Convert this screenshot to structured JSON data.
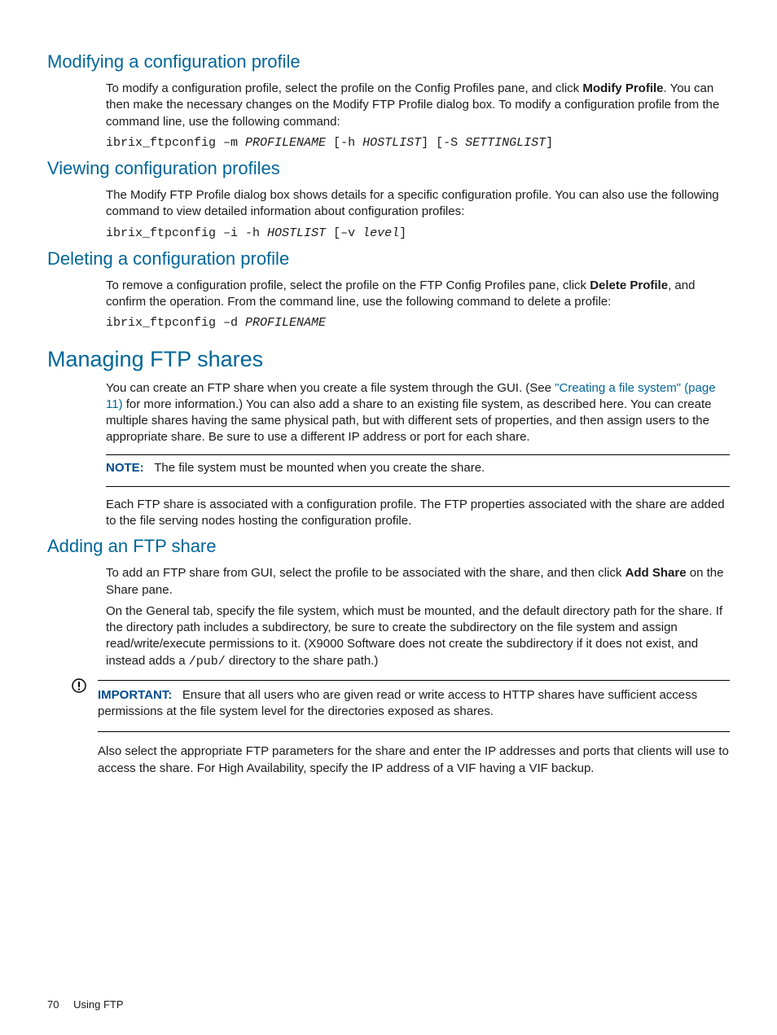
{
  "sections": {
    "modify": {
      "heading": "Modifying a configuration profile",
      "p_before": "To modify a configuration profile, select the profile on the Config Profiles pane, and click ",
      "bold1": "Modify Profile",
      "p_after": ". You can then make the necessary changes on the Modify FTP Profile dialog box. To modify a configuration profile from the command line, use the following command:",
      "cmd_prefix": "ibrix_ftpconfig –m ",
      "cmd_arg1": "PROFILENAME",
      "cmd_mid1": " [-h ",
      "cmd_arg2": "HOSTLIST",
      "cmd_mid2": "] [-S ",
      "cmd_arg3": "SETTINGLIST",
      "cmd_end": "]"
    },
    "viewing": {
      "heading": "Viewing configuration profiles",
      "p": "The Modify FTP Profile dialog box shows details for a specific configuration profile. You can also use the following command to view detailed information about configuration profiles:",
      "cmd_prefix": "ibrix_ftpconfig –i -h ",
      "cmd_arg1": "HOSTLIST",
      "cmd_mid1": " [–v ",
      "cmd_arg2": "level",
      "cmd_end": "]"
    },
    "deleting": {
      "heading": "Deleting a configuration profile",
      "p_before": "To remove a configuration profile, select the profile on the FTP Config Profiles pane, click ",
      "bold1": "Delete Profile",
      "p_after": ", and confirm the operation. From the command line, use the following command to delete a profile:",
      "cmd_prefix": "ibrix_ftpconfig –d ",
      "cmd_arg1": "PROFILENAME"
    },
    "managing": {
      "heading": "Managing FTP shares",
      "p_before": "You can create an FTP share when you create a file system through the GUI. (See ",
      "link": "\"Creating a file system\" (page 11)",
      "p_after": " for more information.) You can also add a share to an existing file system, as described here. You can create multiple shares having the same physical path, but with different sets of properties, and then assign users to the appropriate share. Be sure to use a different IP address or port for each share.",
      "note_label": "NOTE:",
      "note_text": "The file system must be mounted when you create the share.",
      "p2": "Each FTP share is associated with a configuration profile. The FTP properties associated with the share are added to the file serving nodes hosting the configuration profile."
    },
    "adding": {
      "heading": "Adding an FTP share",
      "p1_before": "To add an FTP share from GUI, select the profile to be associated with the share, and then click ",
      "bold1": "Add Share",
      "p1_after": " on the Share pane.",
      "p2_before": "On the General tab, specify the file system, which must be mounted, and the default directory path for the share. If the directory path includes a subdirectory, be sure to create the subdirectory on the file system and assign read/write/execute permissions to it. (X9000 Software does not create the subdirectory if it does not exist, and instead adds a ",
      "p2_mono": "/pub/",
      "p2_after": " directory to the share path.)",
      "important_label": "IMPORTANT:",
      "important_text": "Ensure that all users who are given read or write access to HTTP shares have sufficient access permissions at the file system level for the directories exposed as shares.",
      "p3": "Also select the appropriate FTP parameters for the share and enter the IP addresses and ports that clients will use to access the share. For High Availability, specify the IP address of a VIF having a VIF backup."
    }
  },
  "footer": {
    "page_number": "70",
    "chapter": "Using FTP"
  }
}
